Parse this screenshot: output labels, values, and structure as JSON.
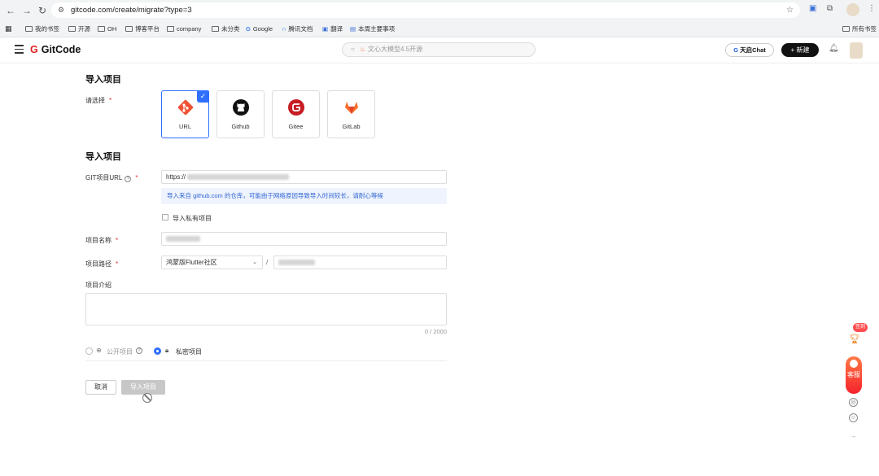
{
  "browser": {
    "url": "gitcode.com/create/migrate?type=3",
    "bookmarks": [
      "我的书签",
      "开源",
      "OH",
      "博客平台",
      "company",
      "未分类",
      "Google",
      "腾讯文档",
      "翻译",
      "本周主要事项"
    ],
    "all_bookmarks": "所有书签"
  },
  "header": {
    "logo": "GitCode",
    "search_placeholder": "文心大模型4.5开源",
    "chat_label": "天启Chat",
    "new_label": "+ 新建"
  },
  "form": {
    "section1_title": "导入项目",
    "select_label": "请选择",
    "required_mark": "*",
    "sources": [
      {
        "name": "URL",
        "selected": true
      },
      {
        "name": "Github",
        "selected": false
      },
      {
        "name": "Gitee",
        "selected": false
      },
      {
        "name": "GitLab",
        "selected": false
      }
    ],
    "section2_title": "导入项目",
    "git_url_label": "GIT项目URL",
    "git_url_value": "https://",
    "notice": "导入来自 github.com 的仓库，可能由于网络原因导致导入时间较长，请耐心等候",
    "private_import_label": "导入私有项目",
    "name_label": "项目名称",
    "path_label": "项目路径",
    "namespace_value": "鸿蒙版Flutter社区",
    "path_separator": "/",
    "desc_label": "项目介绍",
    "desc_count": "0 / 2000",
    "visibility": {
      "public": "公开项目",
      "private": "私密项目",
      "selected": "private"
    },
    "cancel_label": "取消",
    "import_label": "导入项目"
  },
  "floating": {
    "sign_label": "签到",
    "service_label": "客服"
  },
  "colors": {
    "accent": "#2f6fff",
    "brand": "#e02020",
    "notice_bg": "#eef3fd"
  }
}
